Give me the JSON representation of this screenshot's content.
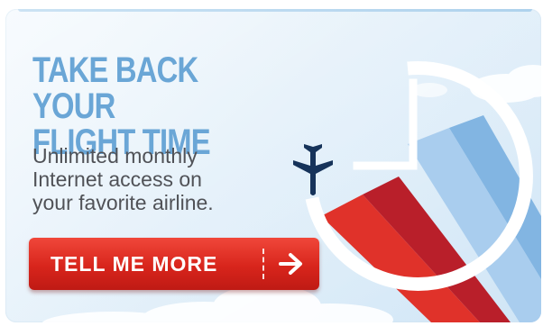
{
  "ad": {
    "headline_line1": "TAKE BACK YOUR",
    "headline_line2": "FLIGHT TIME",
    "subtext_line1": "Unlimited monthly",
    "subtext_line2": "Internet access on",
    "subtext_line3": "your favorite airline.",
    "cta_label": "TELL ME MORE"
  },
  "icons": {
    "airplane": "airplane-icon",
    "clock": "clock-icon",
    "arrow": "right-arrow-icon"
  },
  "colors": {
    "headline": "#6aa6d6",
    "subtext": "#505257",
    "button": "#d8251c",
    "background": "#dcecf8",
    "airplane": "#16335a",
    "stripe_red": "#d92c22",
    "stripe_blue": "#7fb2e0"
  }
}
